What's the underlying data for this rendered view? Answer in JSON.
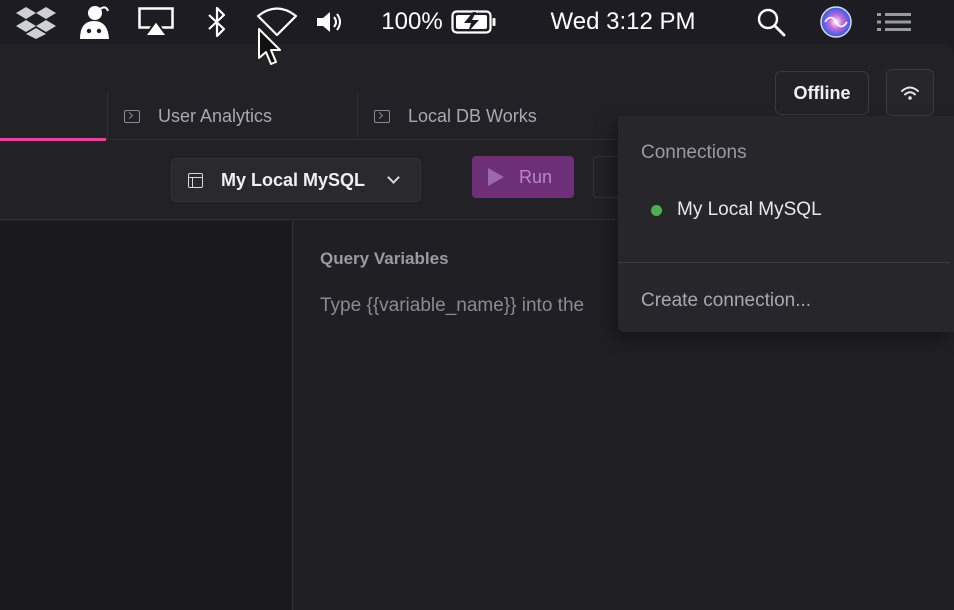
{
  "menubar": {
    "battery": "100%",
    "clock": "Wed 3:12 PM",
    "icons": [
      "dropbox-icon",
      "app-mascot-icon",
      "airplay-icon",
      "bluetooth-icon",
      "wifi-icon",
      "volume-icon",
      "battery-charging-icon",
      "spotlight-search-icon",
      "siri-icon",
      "notification-center-icon"
    ]
  },
  "tabs": [
    {
      "label": "",
      "active": true
    },
    {
      "label": "User Analytics",
      "active": false
    },
    {
      "label": "Local DB Works",
      "active": false
    }
  ],
  "status": {
    "offline_label": "Offline"
  },
  "toolbar": {
    "connection_label": "My Local MySQL",
    "run_label": "Run"
  },
  "query_variables": {
    "title": "Query Variables",
    "hint": "Type {{variable_name}} into the"
  },
  "connections_menu": {
    "header": "Connections",
    "items": [
      {
        "label": "My Local MySQL",
        "status_color": "#4caf50"
      }
    ],
    "create_label": "Create connection..."
  },
  "colors": {
    "accent": "#e5469b",
    "run_button": "#6c2f78",
    "connected": "#4caf50"
  }
}
